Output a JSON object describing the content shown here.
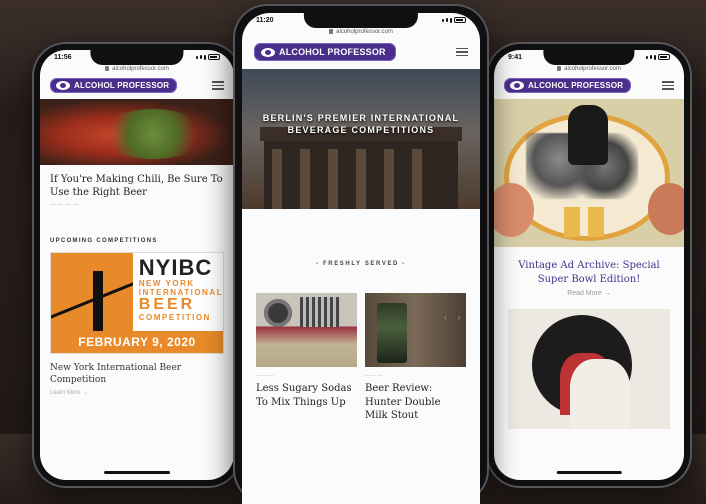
{
  "left": {
    "time": "11:56",
    "url": "alcoholprofessor.com",
    "logo": "ALCOHOL PROFESSOR",
    "post_title": "If You're Making Chili, Be Sure To Use the Right Beer",
    "section": "UPCOMING COMPETITIONS",
    "nyibc": {
      "big": "NYIBC",
      "line1": "NEW YORK",
      "line2": "INTERNATIONAL",
      "beer": "BEER",
      "line3": "COMPETITION",
      "date": "FEBRUARY 9, 2020"
    },
    "post2_title": "New York International Beer Competition",
    "learn": "Learn More →"
  },
  "center": {
    "time": "11:20",
    "url": "alcoholprofessor.com",
    "logo": "ALCOHOL PROFESSOR",
    "hero_title": "BERLIN'S PREMIER INTERNATIONAL BEVERAGE COMPETITIONS",
    "fresh": "- FRESHLY SERVED -",
    "pager": "‹ ›",
    "cards": [
      {
        "title": "Less Sugary Sodas To Mix Things Up"
      },
      {
        "title": "Beer Review: Hunter Double Milk Stout"
      }
    ]
  },
  "right": {
    "time": "9:41",
    "url": "alcoholprofessor.com",
    "logo": "ALCOHOL PROFESSOR",
    "post_title": "Vintage Ad Archive: Special Super Bowl Edition!",
    "read": "Read More →"
  }
}
